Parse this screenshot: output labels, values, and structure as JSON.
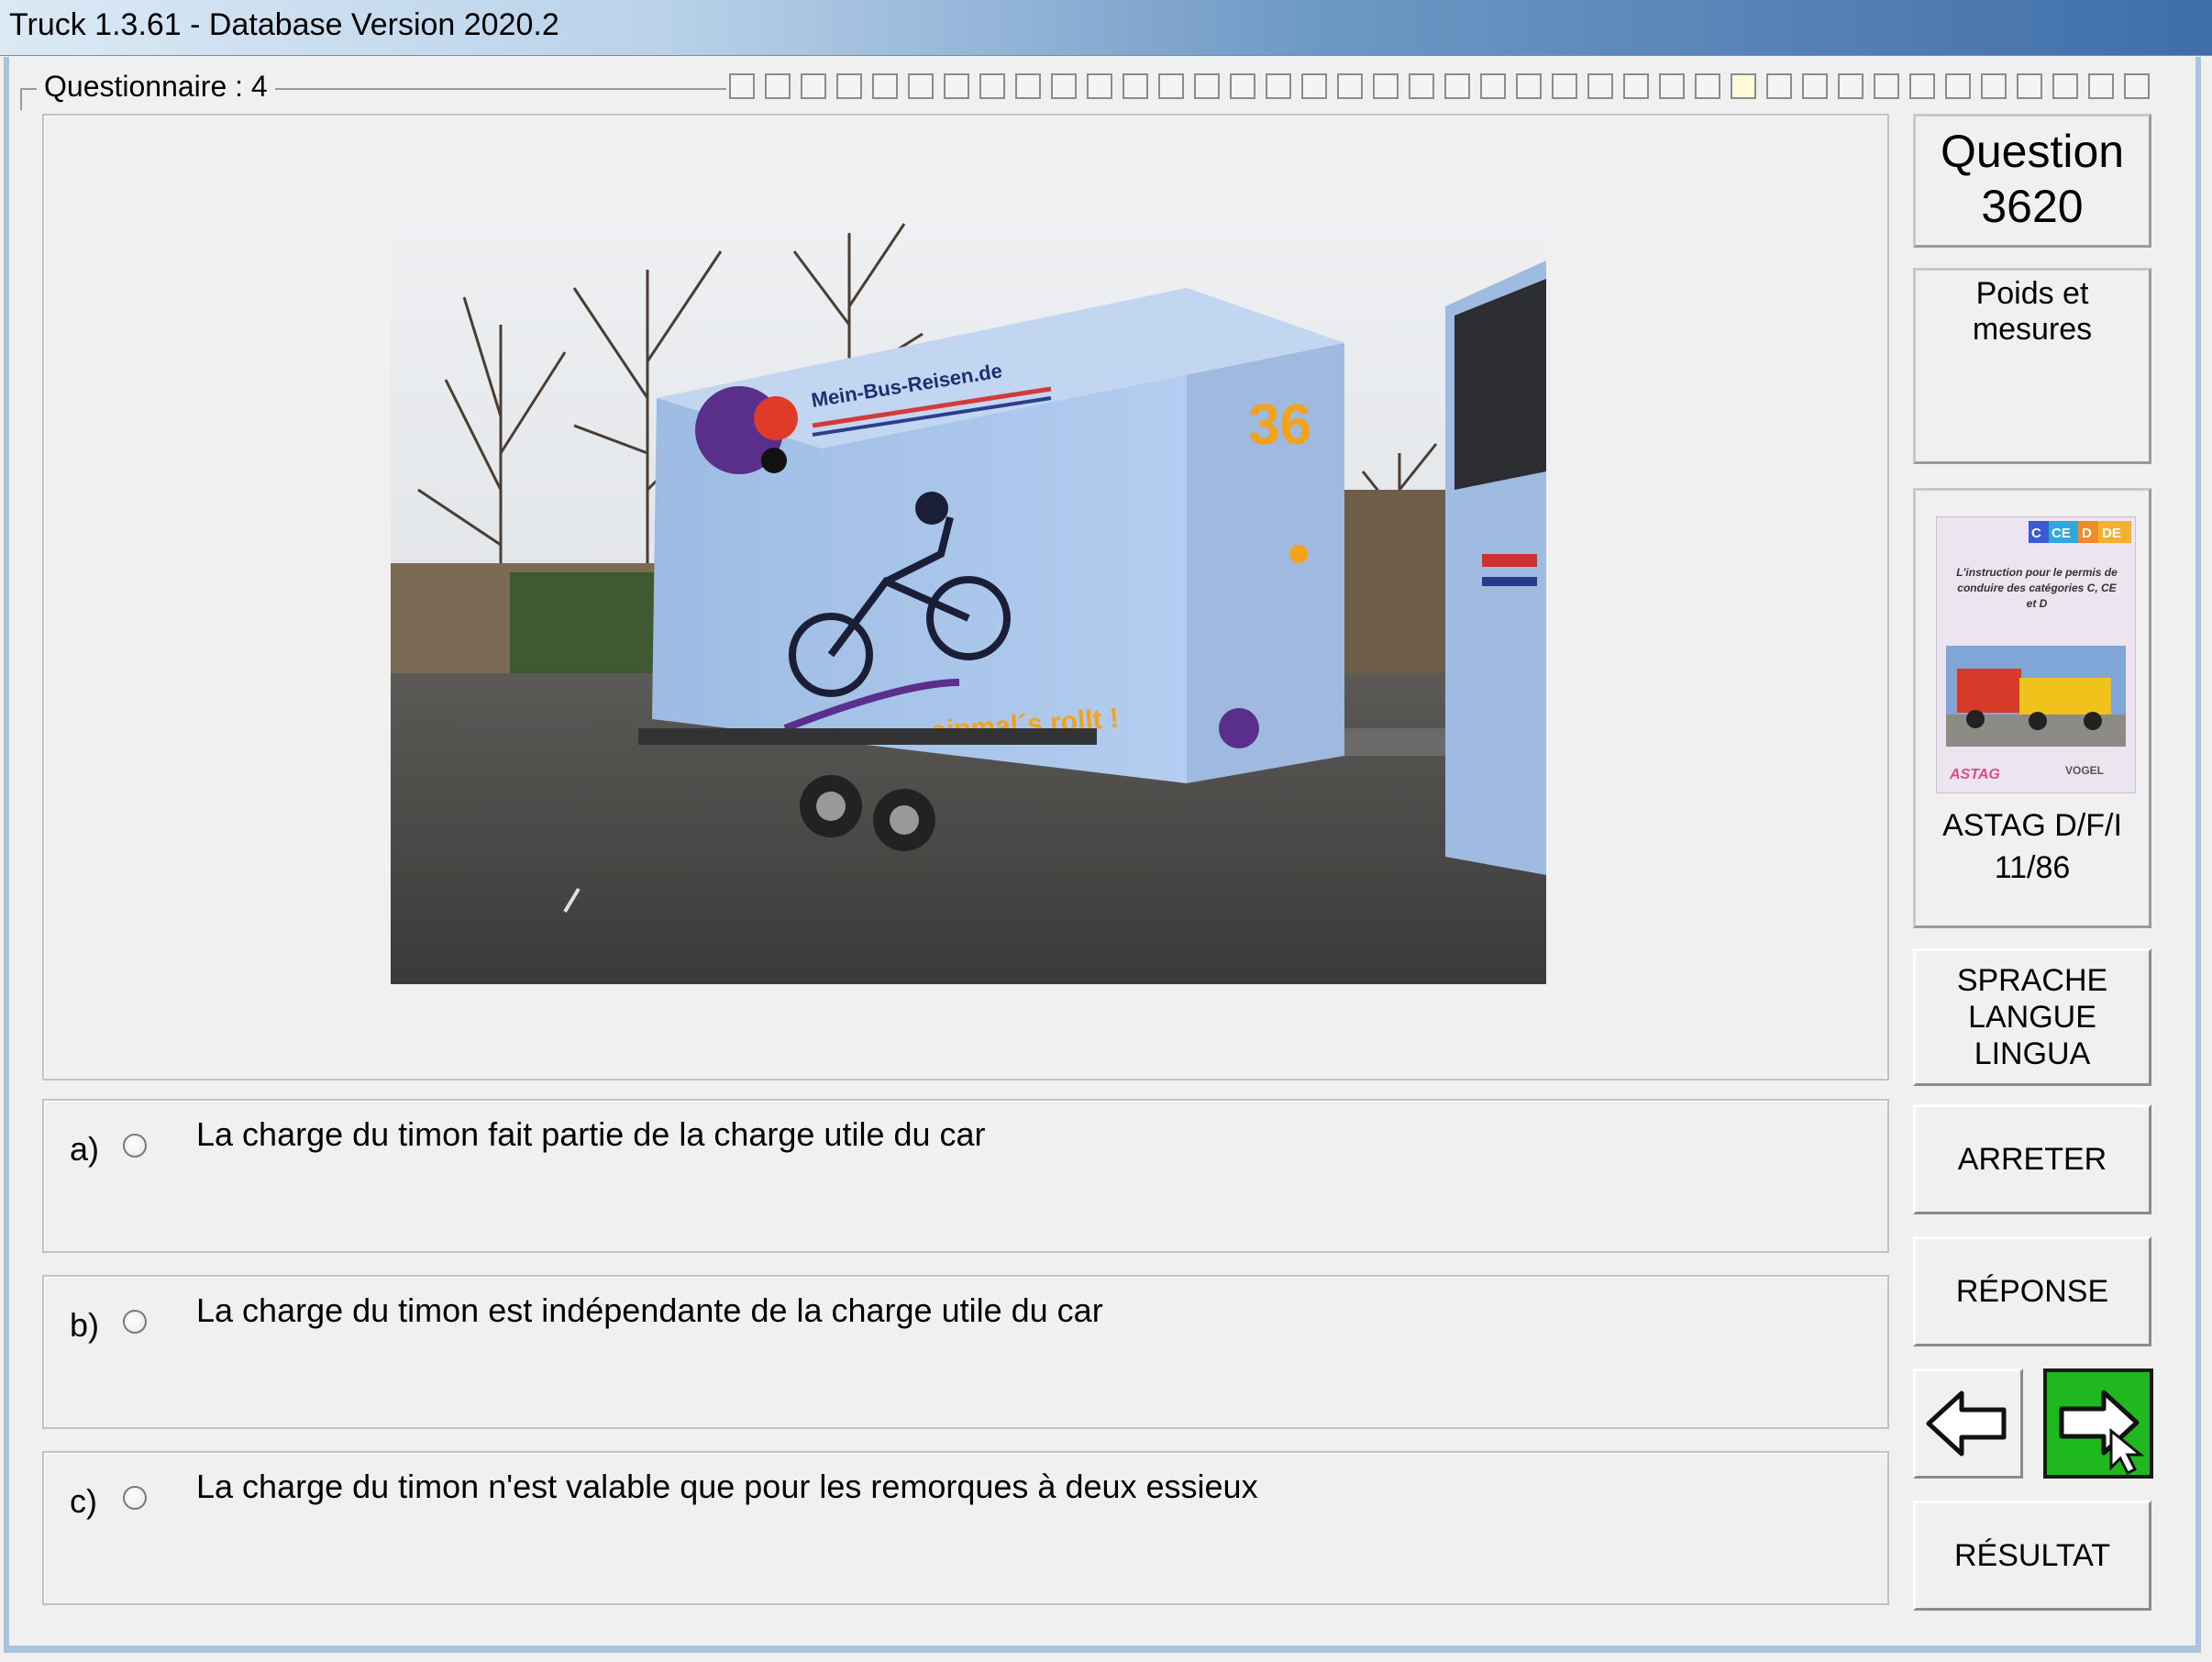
{
  "window": {
    "title": "Truck 1.3.61 - Database Version 2020.2"
  },
  "group": {
    "label": "Questionnaire : 4"
  },
  "progress": {
    "total": 40,
    "current": 28
  },
  "question": {
    "title_line1": "Question",
    "number": "3620",
    "category": "Poids et mesures"
  },
  "book": {
    "cover_badges": [
      "C",
      "CE",
      "D",
      "DE"
    ],
    "cover_text": "L'instruction pour le permis de conduire des catégories C, CE et D",
    "cover_logo_left": "ASTAG",
    "cover_logo_right": "VOGEL",
    "label_line1": "ASTAG D/F/I",
    "label_line2": "11/86"
  },
  "photo": {
    "trailer_url": "Mein-Bus-Reisen.de",
    "trailer_number": "36",
    "slogan": "…einmal´s rollt !"
  },
  "answers": [
    {
      "letter": "a)",
      "text": "La charge du timon fait partie de la charge utile du car"
    },
    {
      "letter": "b)",
      "text": "La charge du timon est indépendante de la charge utile du car"
    },
    {
      "letter": "c)",
      "text": "La charge du timon n'est valable que pour les remorques à deux essieux"
    }
  ],
  "buttons": {
    "language": [
      "SPRACHE",
      "LANGUE",
      "LINGUA"
    ],
    "stop": "ARRETER",
    "answer": "RÉPONSE",
    "result": "RÉSULTAT"
  },
  "colors": {
    "next_button": "#1fb81f",
    "trailer": "#a9c6ea",
    "badge_c": "#3b5bd6",
    "badge_ce": "#2fa8e0",
    "badge_d": "#f08a2a",
    "badge_de": "#f2b230"
  }
}
